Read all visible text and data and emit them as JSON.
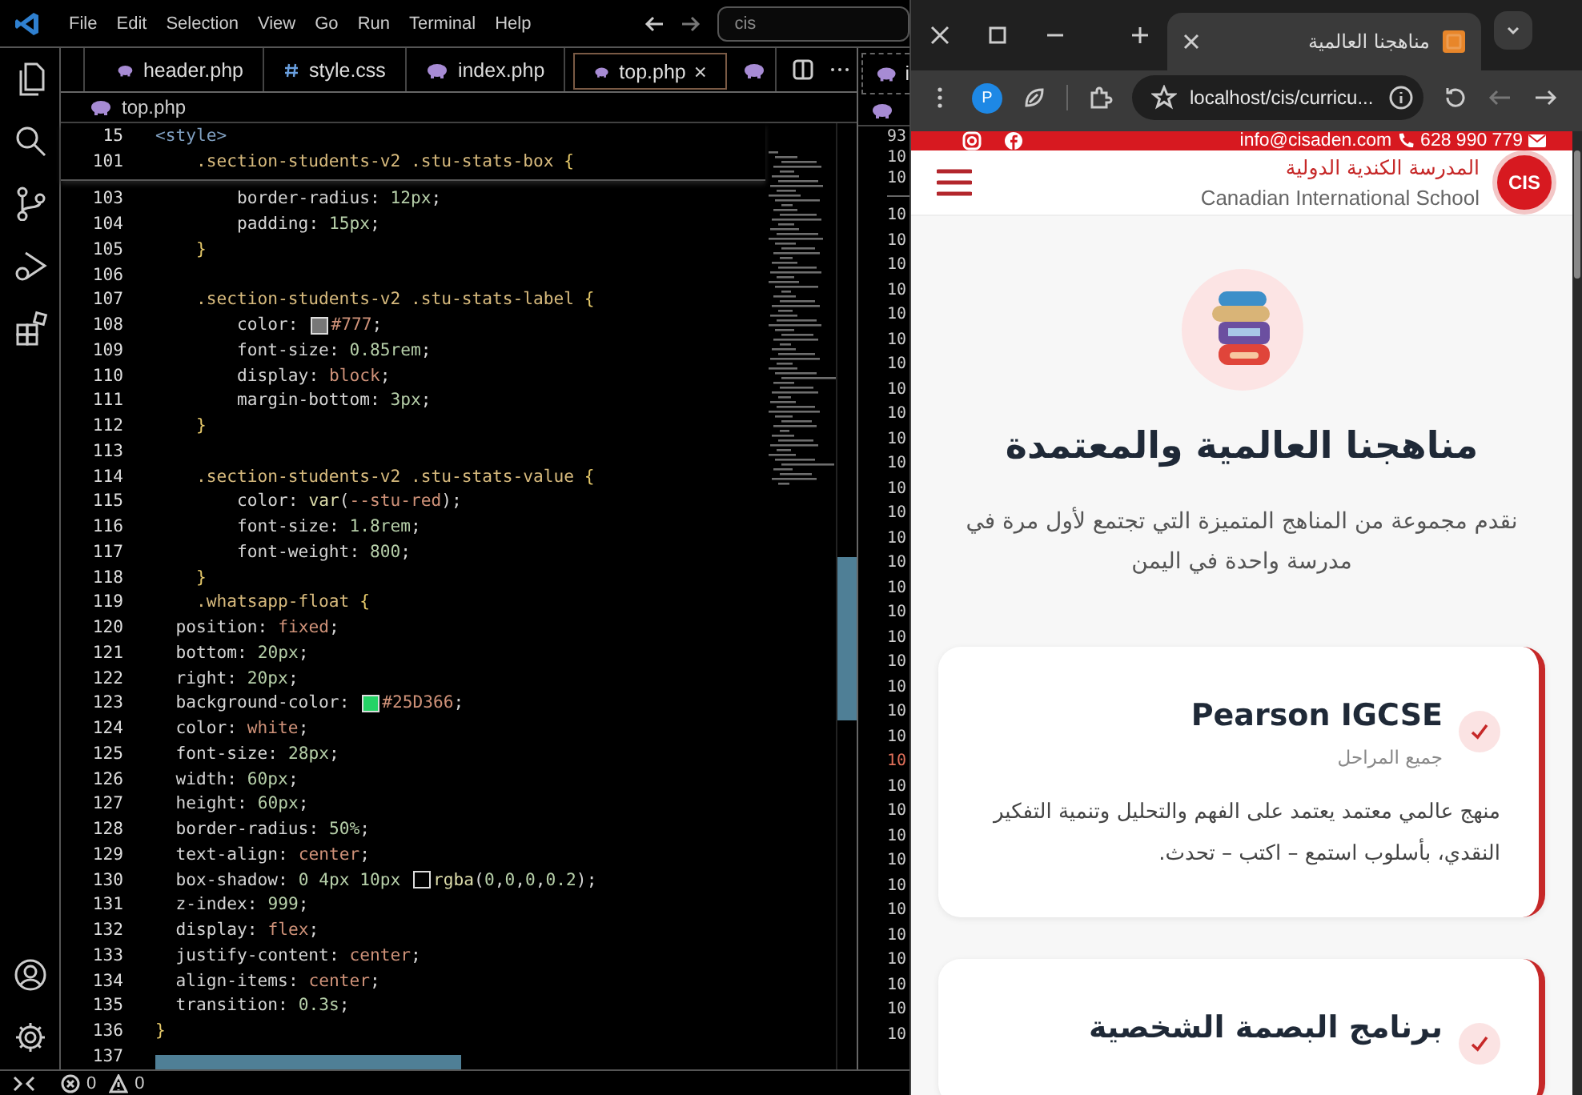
{
  "editor": {
    "menu": [
      "File",
      "Edit",
      "Selection",
      "View",
      "Go",
      "Run",
      "Terminal",
      "Help"
    ],
    "command_center": "cis",
    "tabs": [
      {
        "label": "header.php",
        "kind": "php",
        "selected": false
      },
      {
        "label": "style.css",
        "kind": "css",
        "selected": false
      },
      {
        "label": "index.php",
        "kind": "php",
        "selected": false
      },
      {
        "label": "top.php",
        "kind": "php",
        "selected": true
      }
    ],
    "breadcrumb": "top.php",
    "sticky_lines": [
      {
        "number": "15",
        "code": "<style>"
      },
      {
        "number": "101",
        "code": "    .section-students-v2 .stu-stats-box {"
      }
    ],
    "lines": [
      {
        "number": "103",
        "code": "        border-radius: 12px;"
      },
      {
        "number": "104",
        "code": "        padding: 15px;"
      },
      {
        "number": "105",
        "code": "    }"
      },
      {
        "number": "106"
      },
      {
        "number": "107",
        "code": "    .section-students-v2 .stu-stats-label {"
      },
      {
        "number": "108",
        "code": "        color: #777;"
      },
      {
        "number": "109",
        "code": "        font-size: 0.85rem;"
      },
      {
        "number": "110",
        "code": "        display: block;"
      },
      {
        "number": "111",
        "code": "        margin-bottom: 3px;"
      },
      {
        "number": "112",
        "code": "    }"
      },
      {
        "number": "113"
      },
      {
        "number": "114",
        "code": "    .section-students-v2 .stu-stats-value {"
      },
      {
        "number": "115",
        "code": "        color: var(--stu-red);"
      },
      {
        "number": "116",
        "code": "        font-size: 1.8rem;"
      },
      {
        "number": "117",
        "code": "        font-weight: 800;"
      },
      {
        "number": "118",
        "code": "    }"
      },
      {
        "number": "119",
        "code": "    .whatsapp-float {"
      },
      {
        "number": "120",
        "code": "  position: fixed;"
      },
      {
        "number": "121",
        "code": "  bottom: 20px;"
      },
      {
        "number": "122",
        "code": "  right: 20px;"
      },
      {
        "number": "123",
        "code": "  background-color: #25D366;"
      },
      {
        "number": "124",
        "code": "  color: white;"
      },
      {
        "number": "125",
        "code": "  font-size: 28px;"
      },
      {
        "number": "126",
        "code": "  width: 60px;"
      },
      {
        "number": "127",
        "code": "  height: 60px;"
      },
      {
        "number": "128",
        "code": "  border-radius: 50%;"
      },
      {
        "number": "129",
        "code": "  text-align: center;"
      },
      {
        "number": "130",
        "code": "  box-shadow: 0 4px 10px rgba(0,0,0,0.2);"
      },
      {
        "number": "131",
        "code": "  z-index: 999;"
      },
      {
        "number": "132",
        "code": "  display: flex;"
      },
      {
        "number": "133",
        "code": "  justify-content: center;"
      },
      {
        "number": "134",
        "code": "  align-items: center;"
      },
      {
        "number": "135",
        "code": "  transition: 0.3s;"
      },
      {
        "number": "136",
        "code": "}"
      },
      {
        "number": "137"
      }
    ],
    "second_group": {
      "tab_label": "i",
      "sticky_numbers": [
        "93",
        "10",
        "10"
      ],
      "line_numbers": [
        {
          "text": "10",
          "current": false
        },
        {
          "text": "10",
          "current": false
        },
        {
          "text": "10",
          "current": false
        },
        {
          "text": "10",
          "current": false
        },
        {
          "text": "10",
          "current": false
        },
        {
          "text": "10",
          "current": false
        },
        {
          "text": "10",
          "current": false
        },
        {
          "text": "10",
          "current": false
        },
        {
          "text": "10",
          "current": false
        },
        {
          "text": "10",
          "current": false
        },
        {
          "text": "10",
          "current": false
        },
        {
          "text": "10",
          "current": false
        },
        {
          "text": "10",
          "current": false
        },
        {
          "text": "10",
          "current": false
        },
        {
          "text": "10",
          "current": false
        },
        {
          "text": "10",
          "current": false
        },
        {
          "text": "10",
          "current": false
        },
        {
          "text": "10",
          "current": false
        },
        {
          "text": "10",
          "current": false
        },
        {
          "text": "10",
          "current": false
        },
        {
          "text": "10",
          "current": false
        },
        {
          "text": "10",
          "current": false
        },
        {
          "text": "10",
          "current": true
        },
        {
          "text": "10",
          "current": false
        },
        {
          "text": "10",
          "current": false
        },
        {
          "text": "10",
          "current": false
        },
        {
          "text": "10",
          "current": false
        },
        {
          "text": "10",
          "current": false
        },
        {
          "text": "10",
          "current": false
        },
        {
          "text": "10",
          "current": false
        },
        {
          "text": "10",
          "current": false
        },
        {
          "text": "10",
          "current": false
        },
        {
          "text": "10",
          "current": false
        },
        {
          "text": "10",
          "current": false
        }
      ]
    },
    "status": {
      "errors": "0",
      "warnings": "0"
    }
  },
  "browser": {
    "tab": {
      "title": "مناهجنا العالمية",
      "selected": true
    },
    "profile_initial": "P",
    "address": "localhost/cis/curricu...",
    "topbar": {
      "email": "info@cisaden.com",
      "phone": "628 990 779"
    },
    "header": {
      "name_ar": "المدرسة الكندية الدولية",
      "name_en": "Canadian International School",
      "logo_text": "CIS"
    },
    "hero": {
      "title": "مناهجنا العالمية والمعتمدة",
      "subtitle": "نقدم مجموعة من المناهج المتميزة التي تجتمع لأول مرة في مدرسة واحدة في اليمن"
    },
    "cards": [
      {
        "title": "Pearson IGCSE",
        "subtitle": "جميع المراحل",
        "description": "منهج عالمي معتمد يعتمد على الفهم والتحليل وتنمية التفكير النقدي، بأسلوب استمع – اكتب – تحدث."
      },
      {
        "title": "برنامج البصمة الشخصية"
      }
    ]
  }
}
